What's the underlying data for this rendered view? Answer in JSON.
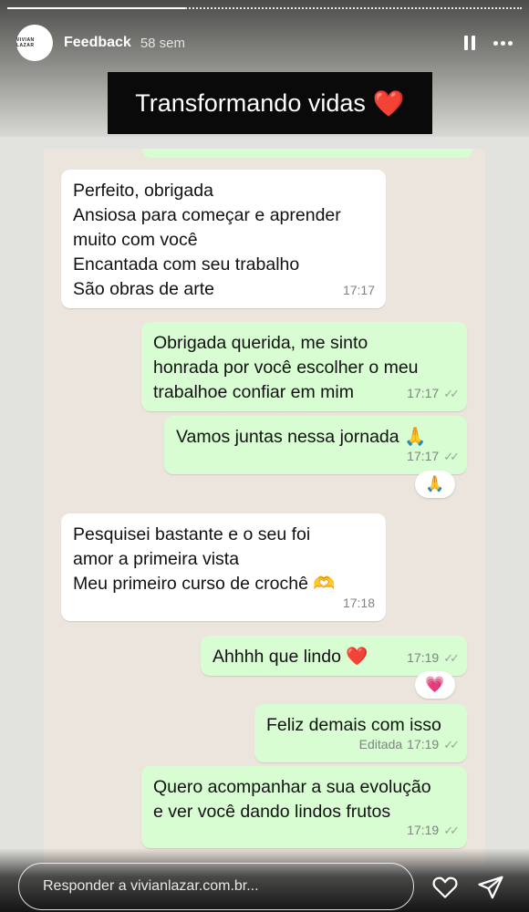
{
  "story": {
    "account": "Feedback",
    "time": "58 sem",
    "avatar_text": "VIVIAN LAZAR",
    "title": "Transformando vidas",
    "title_emoji": "❤️"
  },
  "messages": [
    {
      "direction": "in",
      "lines": [
        "Perfeito, obrigada",
        "Ansiosa para começar e aprender",
        "muito com você",
        "Encantada com seu trabalho",
        "São obras de arte"
      ],
      "time": "17:17"
    },
    {
      "direction": "out",
      "lines": [
        "Obrigada querida, me sinto",
        "honrada por você escolher o meu",
        "trabalhoe confiar em mim"
      ],
      "time": "17:17"
    },
    {
      "direction": "out",
      "lines": [
        "Vamos juntas nessa jornada 🙏"
      ],
      "time": "17:17",
      "reaction": "🙏"
    },
    {
      "direction": "in",
      "lines": [
        "Pesquisei bastante e o seu foi",
        "amor a primeira vista",
        "Meu primeiro curso de crochê 🫶"
      ],
      "time": "17:18"
    },
    {
      "direction": "out",
      "lines": [
        "Ahhhh que lindo ❤️"
      ],
      "time": "17:19",
      "reaction": "💗"
    },
    {
      "direction": "out",
      "lines": [
        "Feliz demais com isso"
      ],
      "time": "17:19",
      "edited": "Editada"
    },
    {
      "direction": "out",
      "lines": [
        "Quero acompanhar a sua evolução",
        "e ver você dando lindos frutos"
      ],
      "time": "17:19"
    }
  ],
  "reply": {
    "placeholder": "Responder a vivianlazar.com.br..."
  },
  "icons": {
    "pause": "pause-icon",
    "more": "more-icon",
    "like": "heart-icon",
    "send": "send-icon",
    "read": "double-check-icon"
  },
  "colors": {
    "incoming_bubble": "#ffffff",
    "outgoing_bubble": "#d8fdd2",
    "chat_background": "#ece5dd"
  }
}
